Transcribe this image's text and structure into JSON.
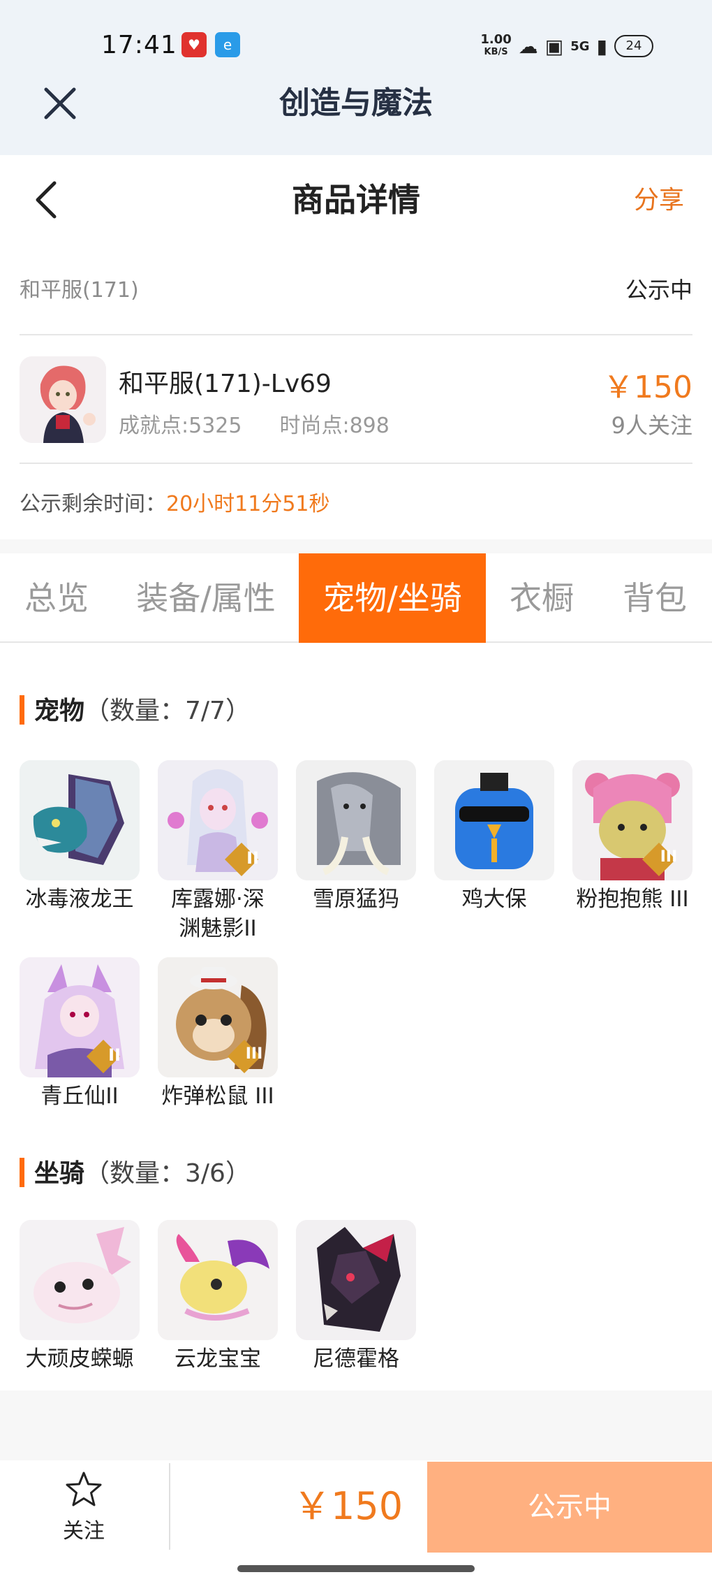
{
  "status_bar": {
    "time": "17:41",
    "net_speed_value": "1.00",
    "net_speed_unit": "KB/S",
    "signal_label": "5G",
    "battery": "24"
  },
  "app": {
    "title": "创造与魔法"
  },
  "nav": {
    "title": "商品详情",
    "share": "分享"
  },
  "server": {
    "name": "和平服(171)",
    "status": "公示中"
  },
  "character": {
    "name": "和平服(171)-Lv69",
    "achievement": "成就点:5325",
    "fashion": "时尚点:898",
    "price": "￥150",
    "followers": "9人关注"
  },
  "timer": {
    "label": "公示剩余时间：",
    "value": "20小时11分51秒"
  },
  "tabs": [
    "总览",
    "装备/属性",
    "宠物/坐骑",
    "衣橱",
    "背包"
  ],
  "active_tab": "宠物/坐骑",
  "pets": {
    "title": "宠物",
    "count": "（数量：7/7）",
    "items": [
      {
        "name": "冰毒液龙王"
      },
      {
        "name": "库露娜·深",
        "name2": "渊魅影II",
        "badge": "II"
      },
      {
        "name": "雪原猛犸"
      },
      {
        "name": "鸡大保"
      },
      {
        "name": "粉抱抱熊 III",
        "badge": "III"
      },
      {
        "name": "青丘仙II",
        "badge": "II"
      },
      {
        "name": "炸弹松鼠 III",
        "badge": "III"
      }
    ]
  },
  "mounts": {
    "title": "坐骑",
    "count": "（数量：3/6）",
    "items": [
      {
        "name": "大顽皮蝾螈"
      },
      {
        "name": "云龙宝宝"
      },
      {
        "name": "尼德霍格"
      }
    ]
  },
  "bottom": {
    "follow": "关注",
    "price": "￥150",
    "action": "公示中"
  },
  "colors": {
    "accent": "#ff6b0a",
    "price": "#f07a1e",
    "header_bg": "#eef3f8",
    "buy_bg": "#ffb080"
  }
}
